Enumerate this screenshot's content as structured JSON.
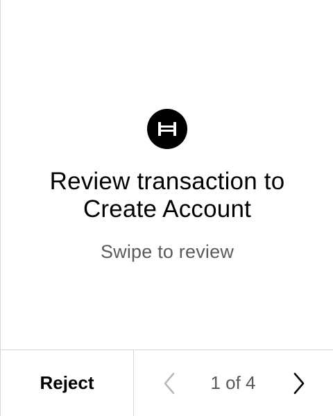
{
  "review": {
    "logo_icon": "hedera-icon",
    "title_line1": "Review transaction to",
    "title_line2": "Create Account",
    "subtitle": "Swipe to review"
  },
  "footer": {
    "reject_label": "Reject",
    "page_indicator": "1 of 4",
    "prev_icon": "chevron-left-icon",
    "next_icon": "chevron-right-icon",
    "prev_enabled": false,
    "next_enabled": true
  },
  "colors": {
    "background": "#ffffff",
    "text_primary": "#000000",
    "text_secondary": "#5a5a5a",
    "divider": "#d6d6d6",
    "disabled_icon": "#b8b8b8"
  }
}
